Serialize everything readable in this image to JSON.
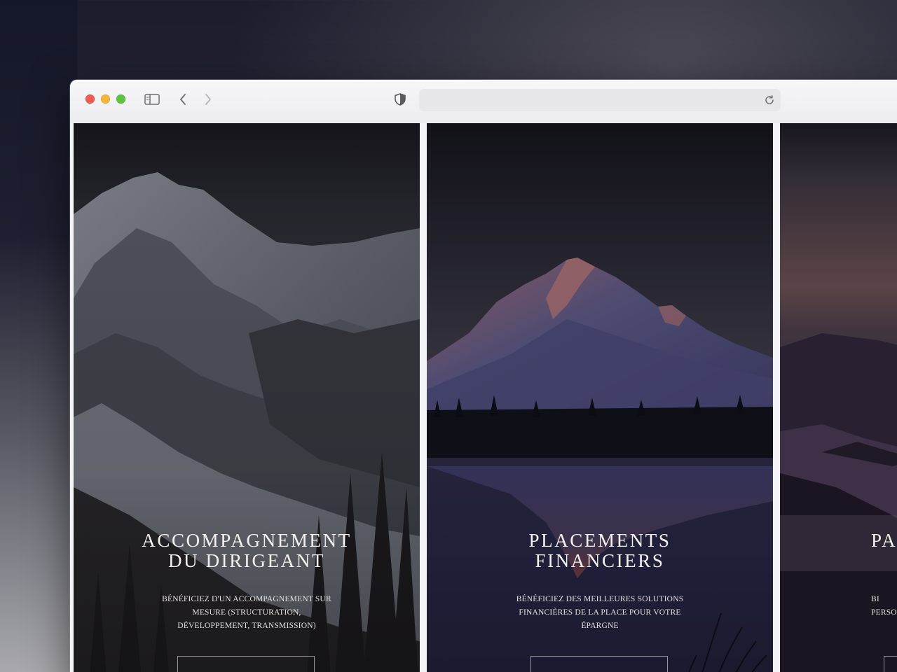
{
  "browser": {
    "url_value": "",
    "icons": {
      "sidebar": "sidebar-toggle-icon",
      "back": "chevron-left-icon",
      "forward": "chevron-right-icon",
      "privacy": "shield-icon",
      "reload": "reload-icon"
    }
  },
  "panels": [
    {
      "title_line1": "ACCOMPAGNEMENT",
      "title_line2": "DU DIRIGEANT",
      "desc_line1": "BÉNÉFICIEZ D'UN ACCOMPAGNEMENT SUR",
      "desc_line2": "MESURE (STRUCTURATION,",
      "desc_line3": "DÉVELOPPEMENT, TRANSMISSION)",
      "cta_label": ""
    },
    {
      "title_line1": "PLACEMENTS",
      "title_line2": "FINANCIERS",
      "desc_line1": "BÉNÉFICIEZ DES MEILLEURES SOLUTIONS",
      "desc_line2": "FINANCIÈRES DE LA PLACE POUR VOTRE",
      "desc_line3": "ÉPARGNE",
      "cta_label": ""
    },
    {
      "title_line1": "PA",
      "title_line2": "",
      "desc_line1": "BI",
      "desc_line2": "PERSO",
      "desc_line3": "",
      "cta_label": ""
    }
  ],
  "colors": {
    "traffic_red": "#ee5b53",
    "traffic_yellow": "#f4b63a",
    "traffic_green": "#5ec43f",
    "panel_text": "#f3f1ee"
  }
}
